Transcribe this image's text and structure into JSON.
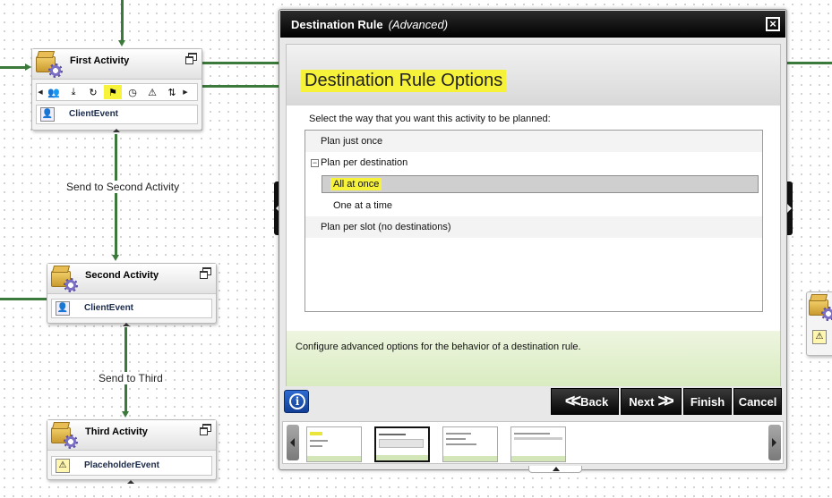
{
  "canvas": {
    "connectors": [
      {
        "label": "Send to Second Activity"
      },
      {
        "label": "Send to Third"
      }
    ],
    "activities": [
      {
        "title": "First Activity",
        "event": "ClientEvent"
      },
      {
        "title": "Second Activity",
        "event": "ClientEvent"
      },
      {
        "title": "Third Activity",
        "event": "PlaceholderEvent"
      }
    ]
  },
  "dialog": {
    "title": "Destination Rule",
    "subtitle": "(Advanced)",
    "heading": "Destination Rule Options",
    "instruction": "Select the way that you want this activity to be planned:",
    "options": {
      "plan_once": "Plan just once",
      "plan_per_destination": "Plan per destination",
      "all_at_once": "All at once",
      "one_at_a_time": "One at a time",
      "plan_per_slot": "Plan per slot (no destinations)"
    },
    "selected_option": "All at once",
    "description": "Configure advanced options for the behavior of a destination rule.",
    "buttons": {
      "back": "Back",
      "next": "Next",
      "finish": "Finish",
      "cancel": "Cancel"
    }
  },
  "colors": {
    "highlight": "#f6f23a",
    "connector": "#3c7a3c",
    "titlebar": "#000000",
    "description_band": "#d9ecc0",
    "info_button": "#1f55b8"
  }
}
